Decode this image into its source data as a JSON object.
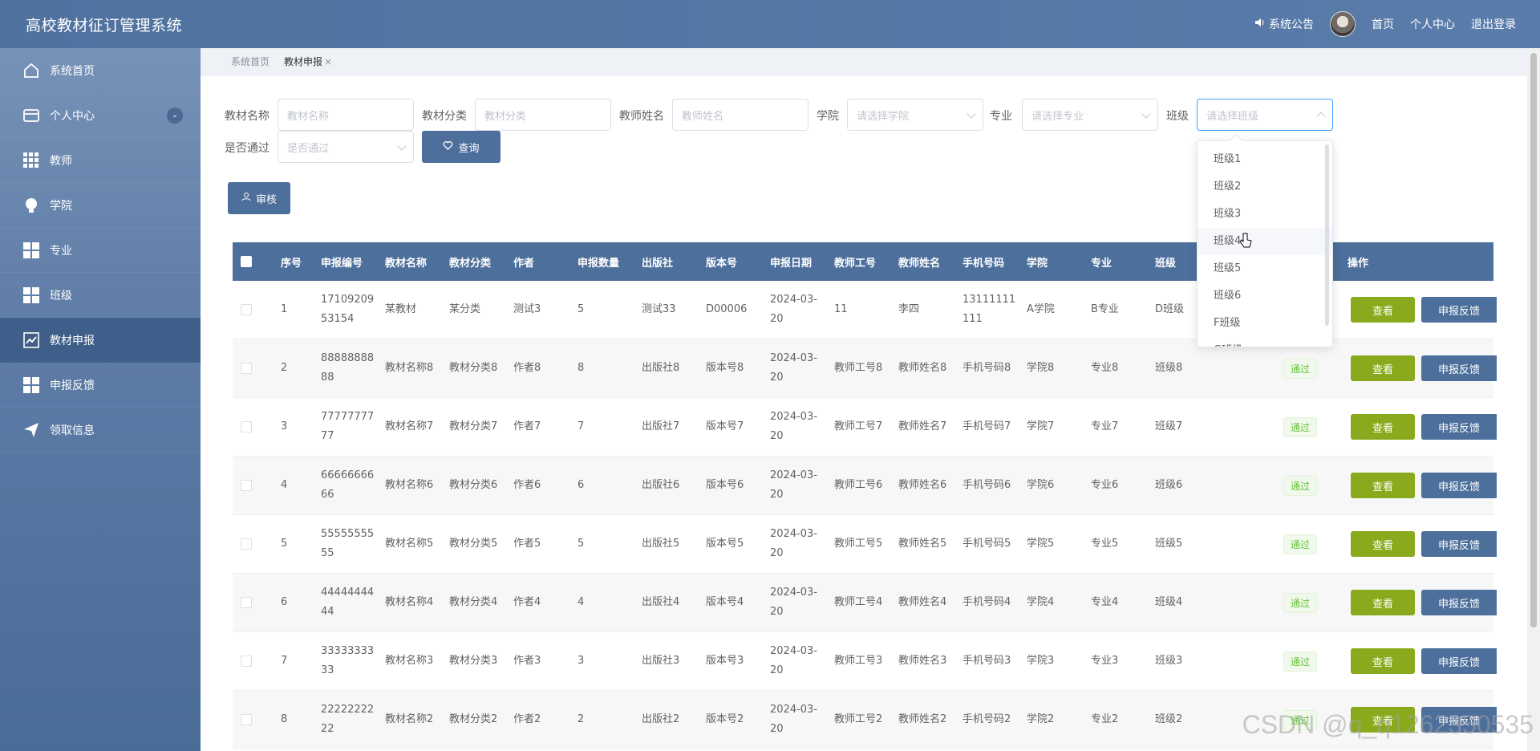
{
  "app": {
    "title": "高校教材征订管理系统",
    "notice": "系统公告",
    "home": "首页",
    "profile": "个人中心",
    "logout": "退出登录"
  },
  "sidebar": {
    "items": [
      {
        "label": "系统首页",
        "icon": "home-icon"
      },
      {
        "label": "个人中心",
        "icon": "card-icon"
      },
      {
        "label": "教师",
        "icon": "grid-icon"
      },
      {
        "label": "学院",
        "icon": "bulb-icon"
      },
      {
        "label": "专业",
        "icon": "grid-icon"
      },
      {
        "label": "班级",
        "icon": "grid-icon"
      },
      {
        "label": "教材申报",
        "icon": "chart-icon"
      },
      {
        "label": "申报反馈",
        "icon": "grid-icon"
      },
      {
        "label": "领取信息",
        "icon": "send-icon"
      }
    ]
  },
  "breadcrumbs": {
    "home": "系统首页",
    "current": "教材申报",
    "close": "×"
  },
  "search": {
    "book_name_label": "教材名称",
    "book_name_placeholder": "教材名称",
    "category_label": "教材分类",
    "category_placeholder": "教材分类",
    "teacher_label": "教师姓名",
    "teacher_placeholder": "教师姓名",
    "college_label": "学院",
    "college_placeholder": "请选择学院",
    "major_label": "专业",
    "major_placeholder": "请选择专业",
    "class_label": "班级",
    "class_placeholder": "请选择班级",
    "passed_label": "是否通过",
    "passed_placeholder": "是否通过",
    "query_button": "查询",
    "audit_button": "审核"
  },
  "class_dropdown": {
    "options": [
      "班级1",
      "班级2",
      "班级3",
      "班级4",
      "班级5",
      "班级6",
      "F班级",
      "G班级"
    ]
  },
  "table": {
    "headers": [
      "序号",
      "申报编号",
      "教材名称",
      "教材分类",
      "作者",
      "申报数量",
      "出版社",
      "版本号",
      "申报日期",
      "教师工号",
      "教师姓名",
      "手机号码",
      "学院",
      "专业",
      "班级",
      "操作"
    ],
    "view_label": "查看",
    "feedback_label": "申报反馈",
    "rows": [
      {
        "idx": "1",
        "code": "1710920953154",
        "name": "某教材",
        "cat": "某分类",
        "author": "测试3",
        "qty": "5",
        "press": "测试33",
        "ver": "D00006",
        "date": "2024-03-20",
        "tid": "11",
        "tname": "李四",
        "phone": "13111111111",
        "college": "A学院",
        "major": "B专业",
        "cls": "D班级",
        "status": ""
      },
      {
        "idx": "2",
        "code": "8888888888",
        "name": "教材名称8",
        "cat": "教材分类8",
        "author": "作者8",
        "qty": "8",
        "press": "出版社8",
        "ver": "版本号8",
        "date": "2024-03-20",
        "tid": "教师工号8",
        "tname": "教师姓名8",
        "phone": "手机号码8",
        "college": "学院8",
        "major": "专业8",
        "cls": "班级8",
        "status": "通过"
      },
      {
        "idx": "3",
        "code": "7777777777",
        "name": "教材名称7",
        "cat": "教材分类7",
        "author": "作者7",
        "qty": "7",
        "press": "出版社7",
        "ver": "版本号7",
        "date": "2024-03-20",
        "tid": "教师工号7",
        "tname": "教师姓名7",
        "phone": "手机号码7",
        "college": "学院7",
        "major": "专业7",
        "cls": "班级7",
        "status": "通过"
      },
      {
        "idx": "4",
        "code": "6666666666",
        "name": "教材名称6",
        "cat": "教材分类6",
        "author": "作者6",
        "qty": "6",
        "press": "出版社6",
        "ver": "版本号6",
        "date": "2024-03-20",
        "tid": "教师工号6",
        "tname": "教师姓名6",
        "phone": "手机号码6",
        "college": "学院6",
        "major": "专业6",
        "cls": "班级6",
        "status": "通过"
      },
      {
        "idx": "5",
        "code": "5555555555",
        "name": "教材名称5",
        "cat": "教材分类5",
        "author": "作者5",
        "qty": "5",
        "press": "出版社5",
        "ver": "版本号5",
        "date": "2024-03-20",
        "tid": "教师工号5",
        "tname": "教师姓名5",
        "phone": "手机号码5",
        "college": "学院5",
        "major": "专业5",
        "cls": "班级5",
        "status": "通过"
      },
      {
        "idx": "6",
        "code": "4444444444",
        "name": "教材名称4",
        "cat": "教材分类4",
        "author": "作者4",
        "qty": "4",
        "press": "出版社4",
        "ver": "版本号4",
        "date": "2024-03-20",
        "tid": "教师工号4",
        "tname": "教师姓名4",
        "phone": "手机号码4",
        "college": "学院4",
        "major": "专业4",
        "cls": "班级4",
        "status": "通过"
      },
      {
        "idx": "7",
        "code": "3333333333",
        "name": "教材名称3",
        "cat": "教材分类3",
        "author": "作者3",
        "qty": "3",
        "press": "出版社3",
        "ver": "版本号3",
        "date": "2024-03-20",
        "tid": "教师工号3",
        "tname": "教师姓名3",
        "phone": "手机号码3",
        "college": "学院3",
        "major": "专业3",
        "cls": "班级3",
        "status": "通过"
      },
      {
        "idx": "8",
        "code": "2222222222",
        "name": "教材名称2",
        "cat": "教材分类2",
        "author": "作者2",
        "qty": "2",
        "press": "出版社2",
        "ver": "版本号2",
        "date": "2024-03-20",
        "tid": "教师工号2",
        "tname": "教师姓名2",
        "phone": "手机号码2",
        "college": "学院2",
        "major": "专业2",
        "cls": "班级2",
        "status": "通过"
      }
    ]
  },
  "watermark": "CSDN @q_q1262350535",
  "colors": {
    "header": "#50729f",
    "sidebar": "#5e7ca6",
    "primary": "#4d6f9b",
    "view_button": "#8aaa1d"
  }
}
